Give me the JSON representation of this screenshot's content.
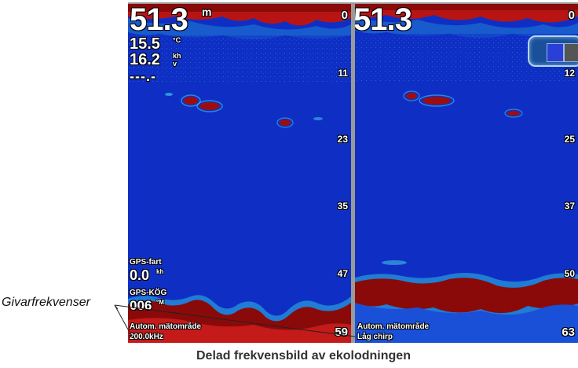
{
  "left_pane": {
    "depth": "51.3",
    "depth_unit": "m",
    "water_temp": "15.5",
    "water_temp_unit": "°C",
    "speed": "16.2",
    "speed_unit": "kh",
    "speed_suffix": "v",
    "dash": "---.-",
    "scale": [
      "0",
      "11",
      "23",
      "35",
      "47",
      "59"
    ],
    "gps_speed_label": "GPS-fart",
    "gps_speed_value": "0.0",
    "gps_speed_unit": "kh",
    "gps_cog_label": "GPS-KÖG",
    "gps_cog_value": "006",
    "gps_cog_unit": "°M",
    "range_label": "Autom. mätområde",
    "frequency_label": "200.0kHz"
  },
  "right_pane": {
    "depth": "51.3",
    "scale": [
      "0",
      "12",
      "25",
      "37",
      "50",
      "63"
    ],
    "range_label": "Autom. mätområde",
    "frequency_label": "Låg chirp"
  },
  "callout": {
    "label": "Givarfrekvenser"
  },
  "caption": "Delad frekvensbild av ekolodningen",
  "colors": {
    "water": "#0f2fc4",
    "echo": "#8a0a0a",
    "text": "#ffffff"
  }
}
